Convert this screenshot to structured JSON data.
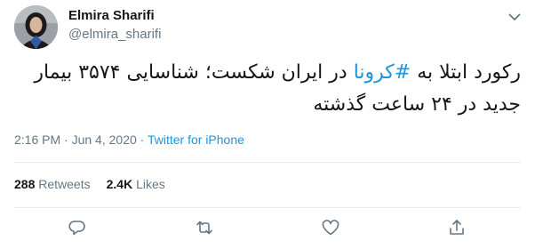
{
  "user": {
    "name": "Elmira Sharifi",
    "handle": "@elmira_sharifi"
  },
  "tweet": {
    "text_before": "رکورد ابتلا به ",
    "hashtag": "#کرونا",
    "text_after": " در ایران شکست؛ شناسایی ۳۵۷۴ بیمار جدید در ۲۴ ساعت گذشته",
    "time": "2:16 PM",
    "separator": " · ",
    "date": "Jun 4, 2020",
    "source": "Twitter for iPhone"
  },
  "stats": {
    "retweets_count": "288",
    "retweets_label": "Retweets",
    "likes_count": "2.4K",
    "likes_label": "Likes"
  },
  "colors": {
    "link": "#1b95e0",
    "secondary": "#657786",
    "text": "#14171a",
    "divider": "#e6ecf0"
  },
  "icons": [
    "chevron-down-icon",
    "reply-icon",
    "retweet-icon",
    "like-icon",
    "share-icon"
  ]
}
